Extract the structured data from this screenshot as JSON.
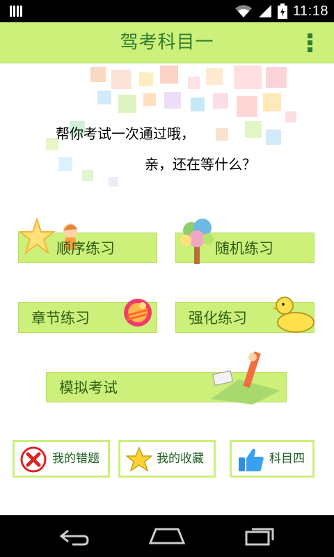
{
  "status_bar": {
    "time": "11:18"
  },
  "app_bar": {
    "title": "驾考科目一"
  },
  "banner": {
    "line1": "帮你考试一次通过哦，",
    "line2": "亲，还在等什么？"
  },
  "practice": {
    "sequential_label": "顺序练习",
    "random_label": "随机练习",
    "chapter_label": "章节练习",
    "intensive_label": "强化练习",
    "mock_exam_label": "模拟考试"
  },
  "bottom": {
    "wrong_label": "我的错题",
    "favorites_label": "我的收藏",
    "subject4_label": "科目四"
  },
  "colors": {
    "accent": "#ccf07a",
    "title_text": "#2e7d32",
    "button_text": "#2e5e12"
  }
}
